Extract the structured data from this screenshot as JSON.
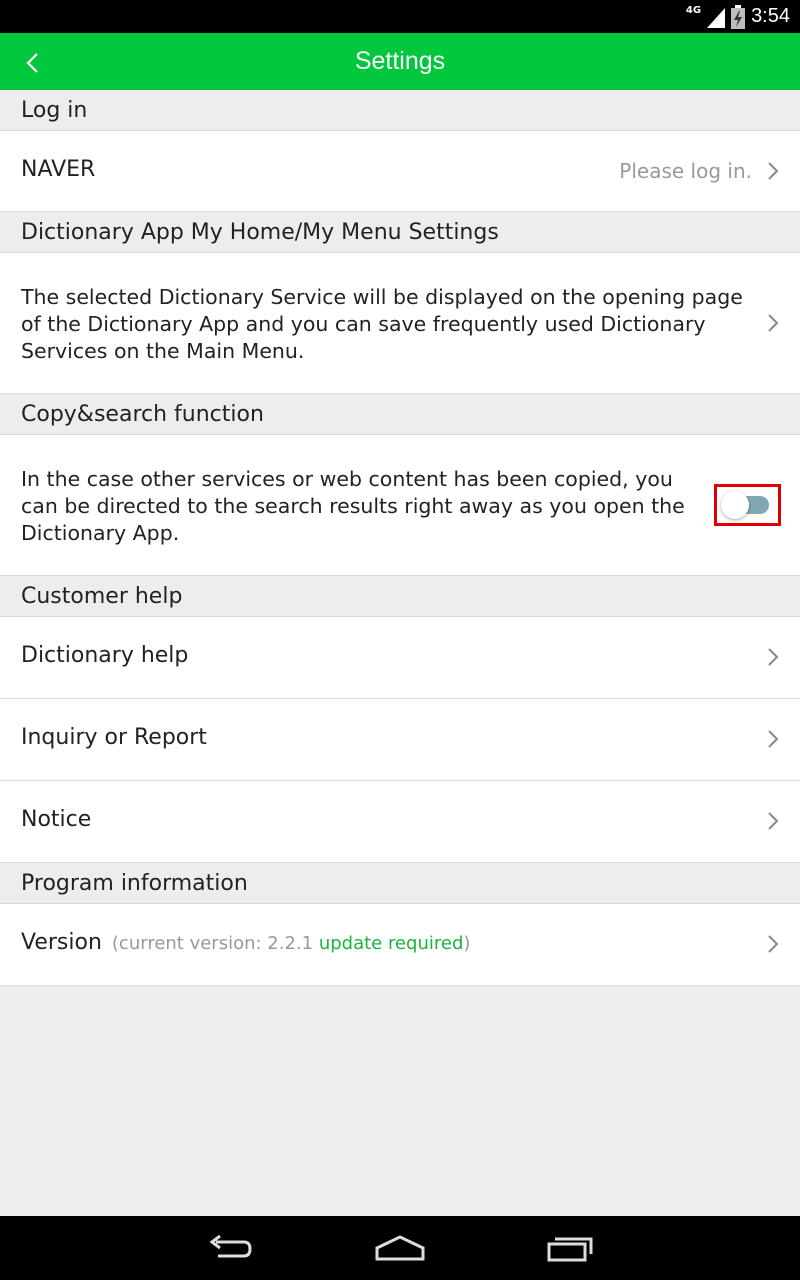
{
  "status_bar": {
    "network": "4G",
    "time": "3:54"
  },
  "app_bar": {
    "title": "Settings"
  },
  "sections": {
    "login": {
      "header": "Log in",
      "naver_label": "NAVER",
      "naver_hint": "Please log in."
    },
    "home": {
      "header": "Dictionary App My Home/My Menu Settings",
      "description": "The selected Dictionary Service will be displayed on the opening page of the Dictionary App and you can save frequently used Dictionary Services on the Main Menu."
    },
    "copy": {
      "header": "Copy&search function",
      "description": "In the case other services or web content has been copied, you can be directed to the search results right away as you open the Dictionary App.",
      "toggle_on": false
    },
    "help": {
      "header": "Customer help",
      "items": [
        "Dictionary help",
        "Inquiry or Report",
        "Notice"
      ]
    },
    "program": {
      "header": "Program information",
      "version_label": "Version",
      "version_open": "(current version: 2.2.1 ",
      "version_update": "update required",
      "version_close": ")"
    }
  },
  "colors": {
    "accent": "#00c73c",
    "update_text": "#1db33f",
    "highlight_box": "#e00000"
  }
}
